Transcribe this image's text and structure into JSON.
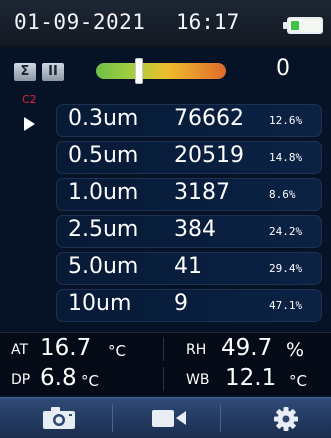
{
  "status": {
    "date": "01-09-2021",
    "time": "16:17",
    "battery_icon": "battery-icon"
  },
  "controls": {
    "sum_label": "Σ",
    "pause_label": "II",
    "level_fraction": 0.32,
    "count": "0"
  },
  "channel": "C2",
  "rows": [
    {
      "size": "0.3um",
      "count": "76662",
      "pct": "12.6%"
    },
    {
      "size": "0.5um",
      "count": "20519",
      "pct": "14.8%"
    },
    {
      "size": "1.0um",
      "count": "3187",
      "pct": "8.6%"
    },
    {
      "size": "2.5um",
      "count": "384",
      "pct": "24.2%"
    },
    {
      "size": "5.0um",
      "count": "41",
      "pct": "29.4%"
    },
    {
      "size": "10um",
      "count": "9",
      "pct": "47.1%"
    }
  ],
  "env": {
    "at_label": "AT",
    "at_value": "16.7",
    "at_unit": "°C",
    "rh_label": "RH",
    "rh_value": "49.7",
    "rh_unit": "%",
    "dp_label": "DP",
    "dp_value": "6.8",
    "dp_unit": "°C",
    "wb_label": "WB",
    "wb_value": "12.1",
    "wb_unit": "°C"
  },
  "toolbar": {
    "icons": [
      "camera-icon",
      "video-icon",
      "settings-icon"
    ]
  },
  "colors": {
    "background": "#061225",
    "channel_tag": "#e2203b",
    "toolbar": "#2f4b78"
  }
}
